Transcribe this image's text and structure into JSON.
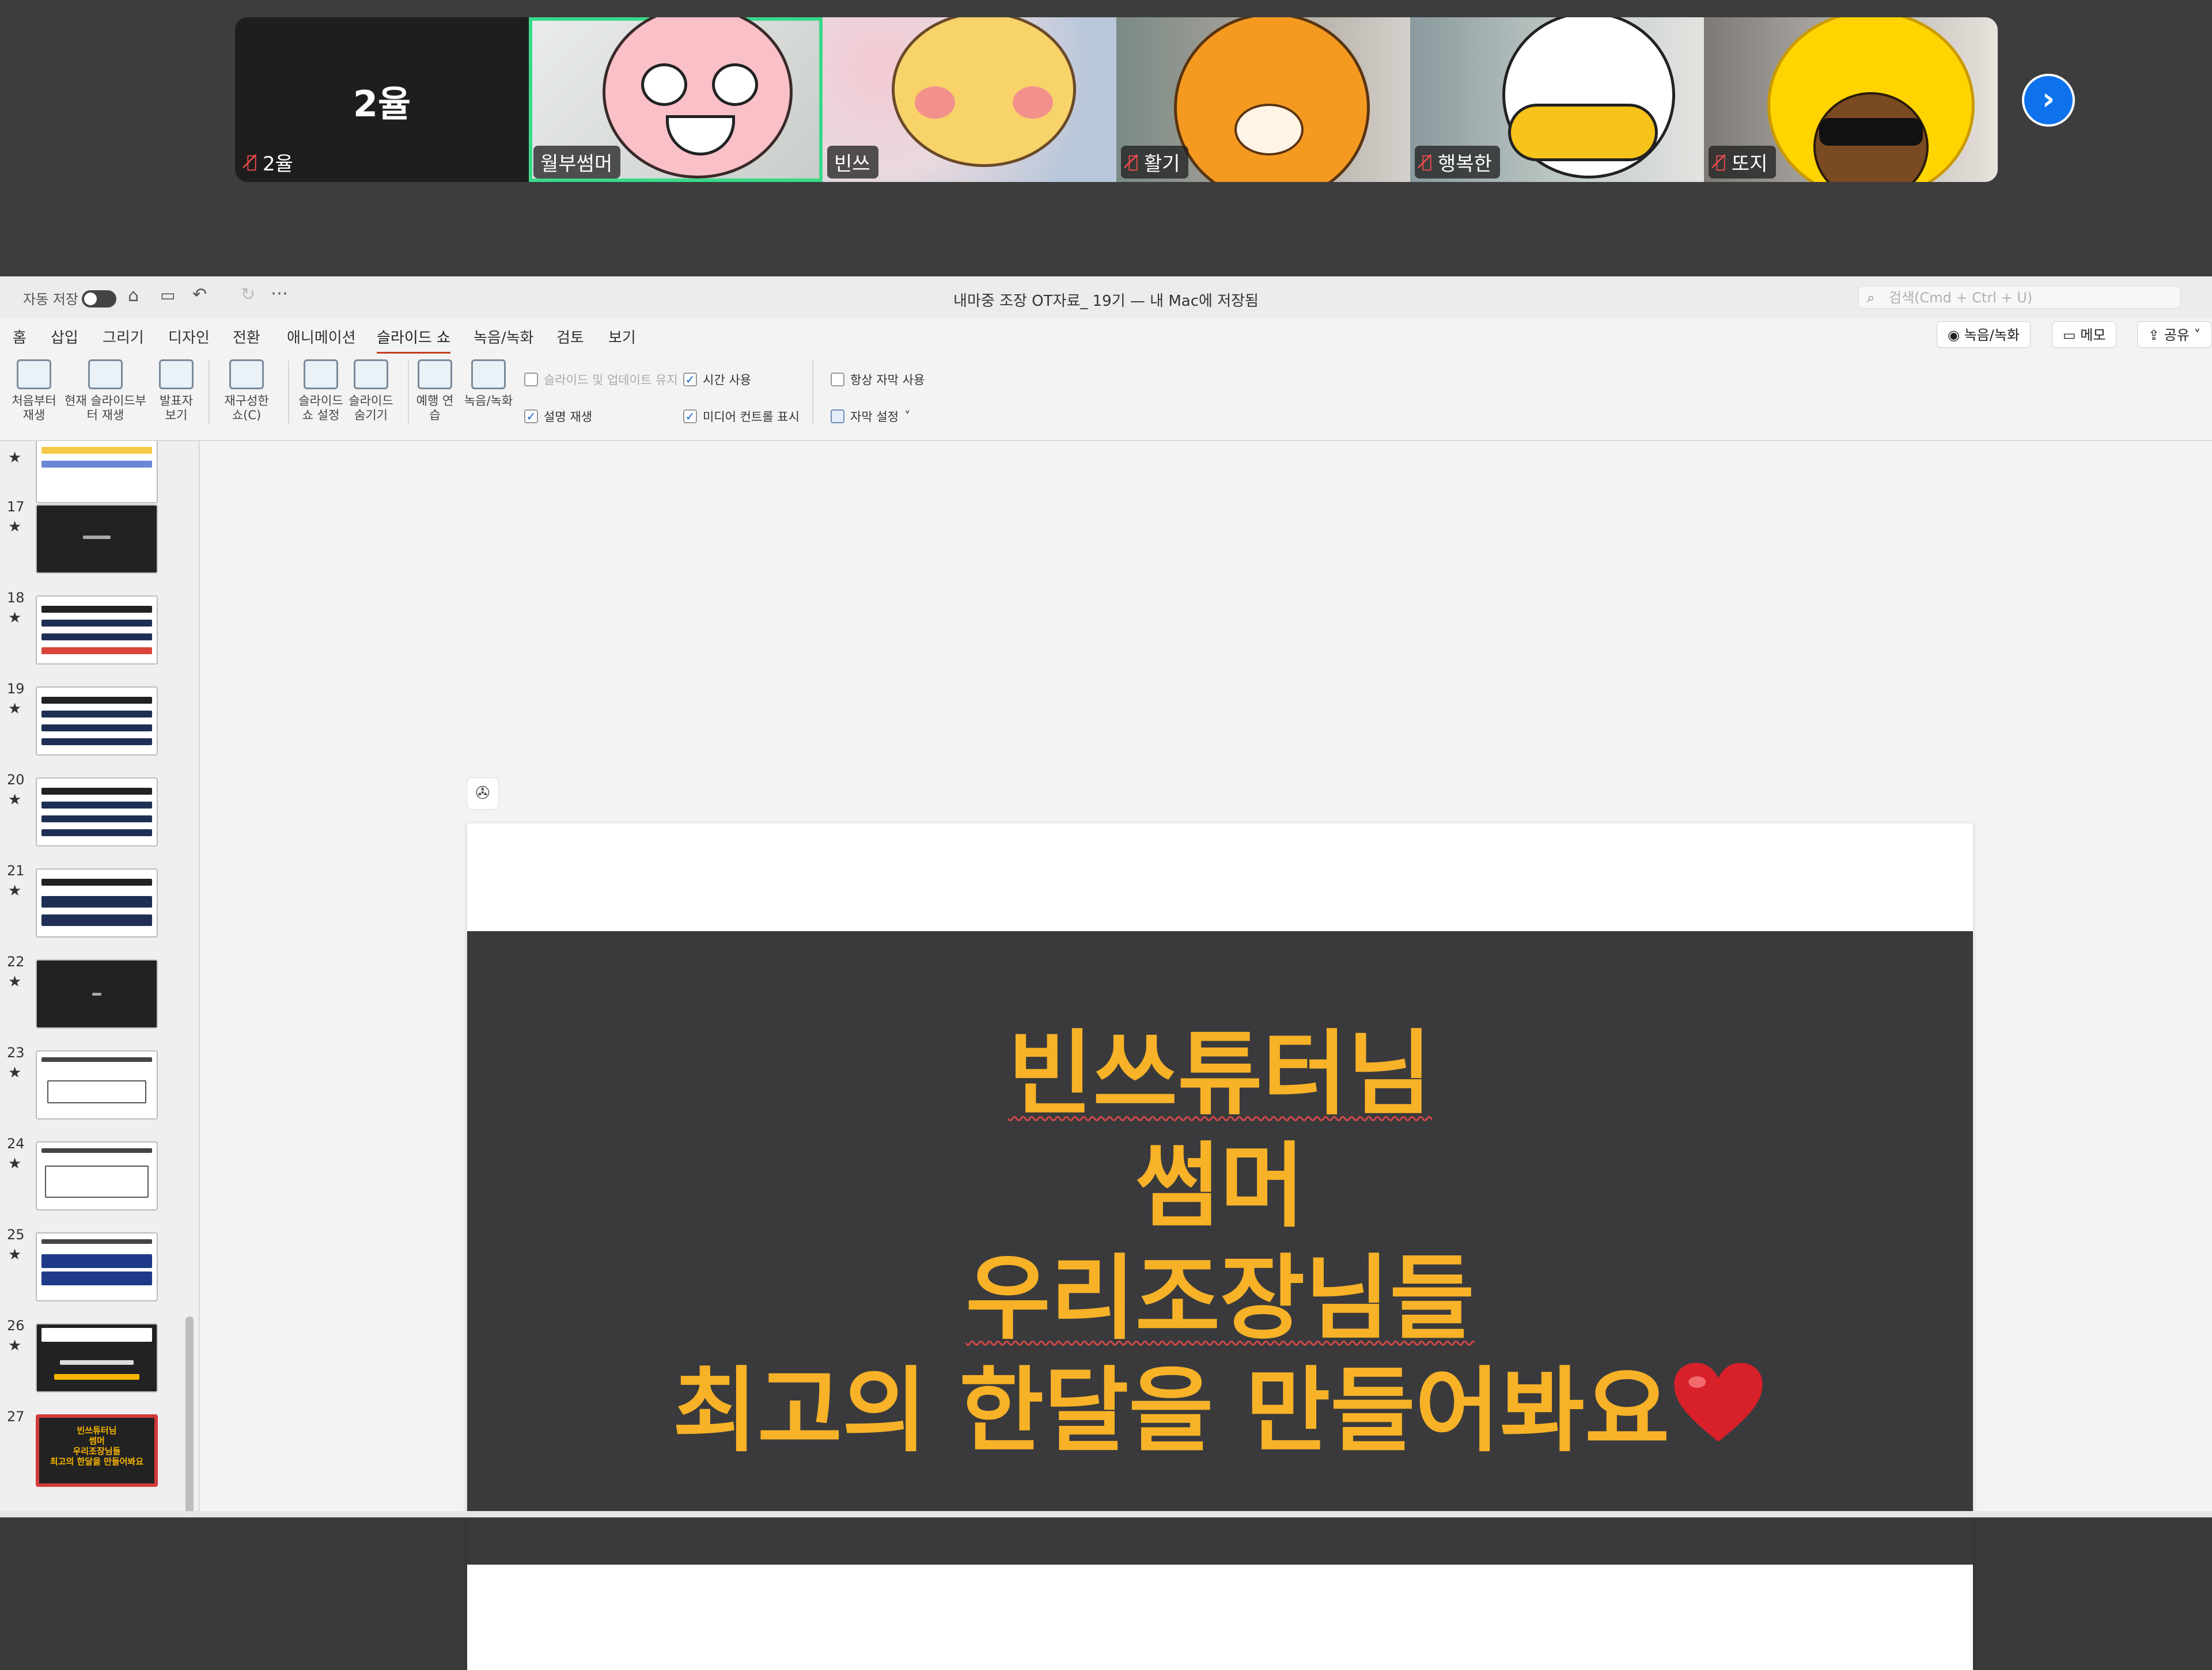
{
  "video_strip": {
    "participants": [
      {
        "tile_label": "2율",
        "name": "2율",
        "muted": true
      },
      {
        "name": "월부썸머",
        "muted": false,
        "active_speaker": true
      },
      {
        "name": "빈쓰",
        "muted": false
      },
      {
        "name": "활기",
        "muted": true
      },
      {
        "name": "행복한",
        "muted": true
      },
      {
        "name": "또지",
        "muted": true
      }
    ],
    "next_icon": "chevron-right-icon"
  },
  "titlebar": {
    "autosave_label": "자동 저장",
    "document_title": "내마중 조장 OT자료_ 19기 — 내 Mac에 저장됨",
    "search_placeholder": "검색(Cmd + Ctrl + U)"
  },
  "menu": {
    "tabs": [
      "홈",
      "삽입",
      "그리기",
      "디자인",
      "전환",
      "애니메이션",
      "슬라이드 쇼",
      "녹음/녹화",
      "검토",
      "보기"
    ],
    "active_tab": "슬라이드 쇼",
    "record_button": "녹음/녹화",
    "memo_button": "메모",
    "share_button": "공유"
  },
  "ribbon": {
    "buttons": [
      "처음부터 재생",
      "현재 슬라이드부터 재생",
      "발표자 보기",
      "재구성한 쇼(C)",
      "슬라이드 쇼 설정",
      "슬라이드 숨기기",
      "예행 연습",
      "녹음/녹화"
    ],
    "checkboxes": {
      "update_slides": {
        "label": "슬라이드 및 업데이트 유지",
        "checked": false
      },
      "use_timings": {
        "label": "시간 사용",
        "checked": true
      },
      "play_narration": {
        "label": "설명 재생",
        "checked": true
      },
      "media_controls": {
        "label": "미디어 컨트롤 표시",
        "checked": true
      },
      "always_subtitles": {
        "label": "항상 자막 사용",
        "checked": false
      }
    },
    "subtitle_settings": "자막 설정"
  },
  "thumbnails": {
    "numbers": [
      "17",
      "18",
      "19",
      "20",
      "21",
      "22",
      "23",
      "24",
      "25",
      "26",
      "27"
    ],
    "selected": "27",
    "selected_preview": [
      "빈쓰튜터님",
      "썸머",
      "우리조장님들",
      "최고의 한달을 만들어봐요"
    ]
  },
  "slide": {
    "lines": [
      "빈쓰튜터님",
      "썸머",
      "우리조장님들",
      "최고의 한달을 만들어봐요"
    ],
    "heart_icon": "heart-icon",
    "text_color": "#f7b228",
    "band_color": "#3a3a3c"
  },
  "colors": {
    "active_speaker_border": "#39d98a",
    "next_button": "#0e72ed",
    "active_tab_underline": "#c43e1c"
  }
}
